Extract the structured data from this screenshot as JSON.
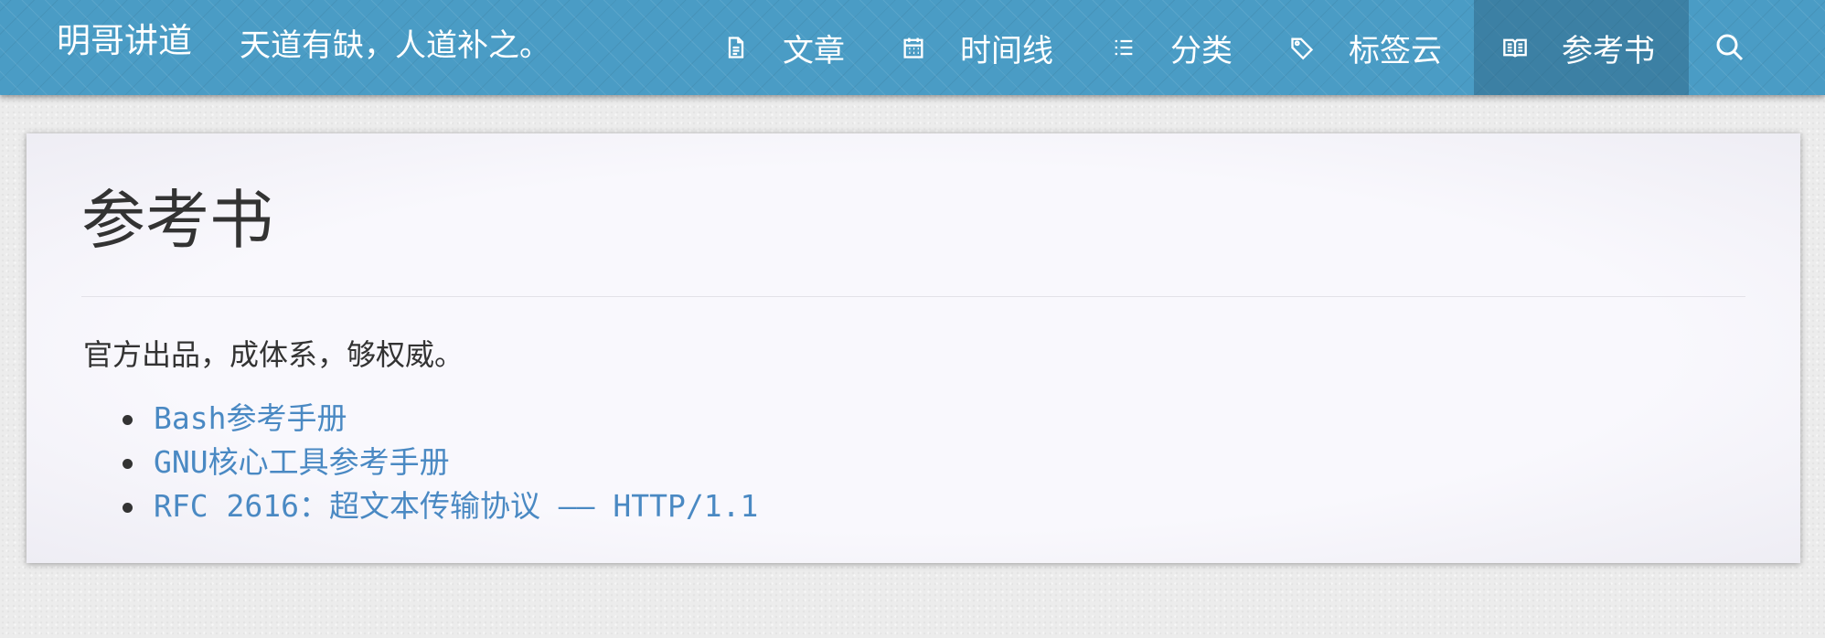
{
  "header": {
    "brand": "明哥讲道",
    "tagline": "天道有缺，人道补之。",
    "nav": [
      {
        "label": "文章",
        "icon": "document-icon"
      },
      {
        "label": "时间线",
        "icon": "calendar-icon"
      },
      {
        "label": "分类",
        "icon": "list-icon"
      },
      {
        "label": "标签云",
        "icon": "tag-icon"
      },
      {
        "label": "参考书",
        "icon": "book-icon",
        "active": true
      }
    ],
    "search_icon": "search-icon"
  },
  "main": {
    "title": "参考书",
    "intro": "官方出品，成体系，够权威。",
    "books": [
      {
        "label": "Bash参考手册"
      },
      {
        "label": "GNU核心工具参考手册"
      },
      {
        "label": "RFC 2616：超文本传输协议 —— HTTP/1.1"
      }
    ]
  },
  "colors": {
    "header_bg": "#4a9cc5",
    "active_nav_bg": "#3b7a9b",
    "link": "#4a89c3",
    "text": "#333333"
  }
}
